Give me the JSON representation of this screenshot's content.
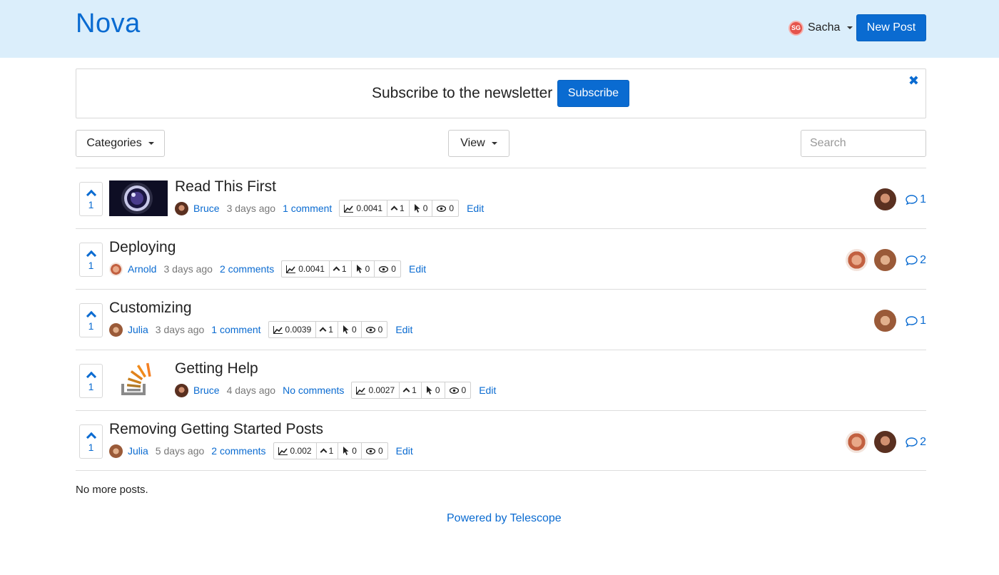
{
  "header": {
    "logo": "Nova",
    "user": {
      "initials": "SG",
      "name": "Sacha"
    },
    "new_post_label": "New Post"
  },
  "newsletter": {
    "text": "Subscribe to the newsletter",
    "button": "Subscribe",
    "close": "✖"
  },
  "filters": {
    "categories_label": "Categories",
    "view_label": "View",
    "search_placeholder": "Search"
  },
  "posts": [
    {
      "votes": "1",
      "title": "Read This First",
      "author": "Bruce",
      "time": "3 days ago",
      "comments": "1 comment",
      "score": "0.0041",
      "upvotes": "1",
      "clicks": "0",
      "views": "0",
      "edit": "Edit",
      "commenters": [
        "Bruce"
      ],
      "comment_count": "1",
      "thumbnail": "lens"
    },
    {
      "votes": "1",
      "title": "Deploying",
      "author": "Arnold",
      "time": "3 days ago",
      "comments": "2 comments",
      "score": "0.0041",
      "upvotes": "1",
      "clicks": "0",
      "views": "0",
      "edit": "Edit",
      "commenters": [
        "Arnold",
        "Julia"
      ],
      "comment_count": "2",
      "thumbnail": ""
    },
    {
      "votes": "1",
      "title": "Customizing",
      "author": "Julia",
      "time": "3 days ago",
      "comments": "1 comment",
      "score": "0.0039",
      "upvotes": "1",
      "clicks": "0",
      "views": "0",
      "edit": "Edit",
      "commenters": [
        "Julia"
      ],
      "comment_count": "1",
      "thumbnail": ""
    },
    {
      "votes": "1",
      "title": "Getting Help",
      "author": "Bruce",
      "time": "4 days ago",
      "comments": "No comments",
      "score": "0.0027",
      "upvotes": "1",
      "clicks": "0",
      "views": "0",
      "edit": "Edit",
      "commenters": [],
      "comment_count": "",
      "thumbnail": "stackoverflow"
    },
    {
      "votes": "1",
      "title": "Removing Getting Started Posts",
      "author": "Julia",
      "time": "5 days ago",
      "comments": "2 comments",
      "score": "0.002",
      "upvotes": "1",
      "clicks": "0",
      "views": "0",
      "edit": "Edit",
      "commenters": [
        "Arnold",
        "Bruce"
      ],
      "comment_count": "2",
      "thumbnail": ""
    }
  ],
  "footer": {
    "no_more": "No more posts.",
    "powered_by": "Powered by Telescope"
  },
  "colors": {
    "accent": "#0a6bd1",
    "header_bg": "#dbeefb"
  }
}
